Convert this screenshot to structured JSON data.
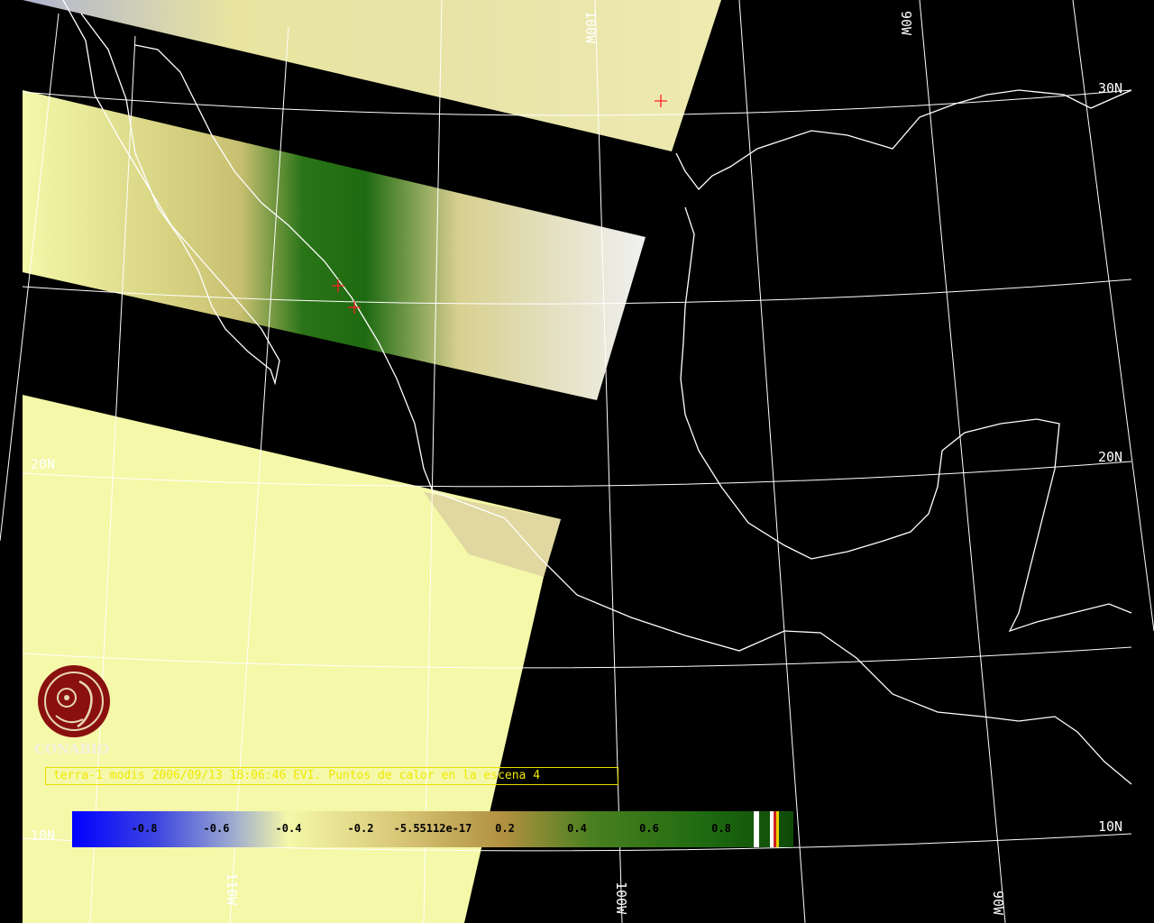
{
  "map": {
    "latitude_labels": [
      "30N",
      "20N",
      "10N"
    ],
    "longitude_labels": [
      "110W",
      "100W",
      "90W"
    ],
    "colors": {
      "land_low": "#f4f8a8",
      "vegetation_dark": "#1e6a10",
      "vegetation_mid": "#7a8a30",
      "coast": "#ffffff",
      "grid": "#ffffff",
      "ocean": "#000000",
      "hotspot": "#ff2020"
    }
  },
  "caption": {
    "text": "terra-1 modis 2006/09/13 18:06:46 EVI. Puntos de calor en la escena 4"
  },
  "logo": {
    "name": "CONABIO",
    "icon": "conabio-macaw-logo-icon"
  },
  "colorbar": {
    "ticks": [
      "-0.8",
      "-0.6",
      "-0.4",
      "-0.2",
      "-5.55112e-17",
      "0.2",
      "0.4",
      "0.6",
      "0.8"
    ],
    "range": [
      -1,
      1
    ],
    "colors": [
      "#0000ff",
      "#9aa8d0",
      "#f4f8a8",
      "#d8c878",
      "#b09040",
      "#4a8020",
      "#1e6a10",
      "#0e4a08"
    ]
  }
}
